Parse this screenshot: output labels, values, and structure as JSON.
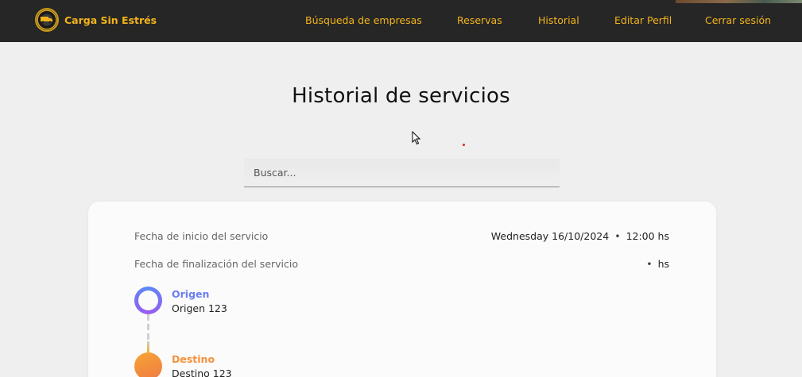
{
  "navbar": {
    "brand": "Carga Sin Estrés",
    "links": [
      "Búsqueda de empresas",
      "Reservas",
      "Historial",
      "Editar Perfil",
      "Cerrar sesión"
    ]
  },
  "page": {
    "title": "Historial de servicios"
  },
  "search": {
    "placeholder": "Buscar..."
  },
  "service": {
    "start_label": "Fecha de inicio del servicio",
    "start_date": "Wednesday 16/10/2024",
    "start_separator": "•",
    "start_time": "12:00 hs",
    "end_label": "Fecha de finalización del servicio",
    "end_separator": "•",
    "end_time": "hs",
    "origin_label": "Origen",
    "origin_address": "Origen 123",
    "destination_label": "Destino",
    "destination_address": "Destino 123"
  },
  "colors": {
    "brand_accent": "#f3b41b",
    "navbar_bg": "#262626",
    "origin_accent": "#6b7ef0",
    "destination_accent": "#f5913a"
  }
}
